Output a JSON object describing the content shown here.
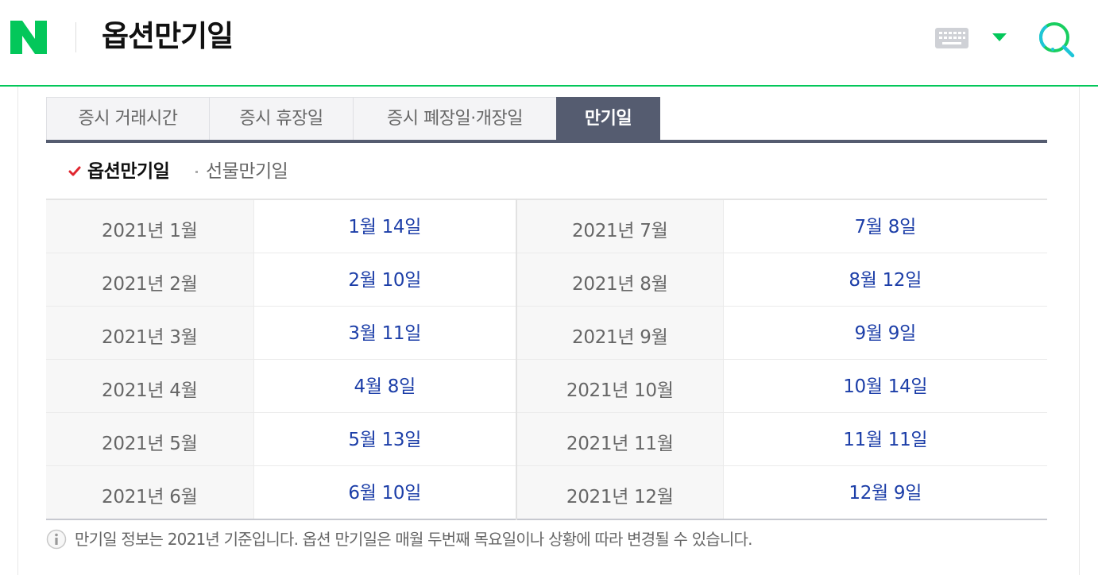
{
  "header": {
    "logo_letter": "N",
    "title": "옵션만기일",
    "keyboard_icon": "keyboard-icon",
    "dropdown_icon": "caret-down-icon",
    "search_icon": "search-icon",
    "accent_color": "#03c75a"
  },
  "tabs": [
    {
      "label": "증시 거래시간",
      "active": false
    },
    {
      "label": "증시 휴장일",
      "active": false
    },
    {
      "label": "증시 폐장일·개장일",
      "active": false
    },
    {
      "label": "만기일",
      "active": true
    }
  ],
  "subtabs": {
    "active_label": "옵션만기일",
    "inactive_label": "선물만기일",
    "check_color": "#e0262f"
  },
  "table": {
    "rows": [
      {
        "m1": "2021년 1월",
        "d1": "1월 14일",
        "m2": "2021년 7월",
        "d2": "7월 8일"
      },
      {
        "m1": "2021년 2월",
        "d1": "2월 10일",
        "m2": "2021년 8월",
        "d2": "8월 12일"
      },
      {
        "m1": "2021년 3월",
        "d1": "3월 11일",
        "m2": "2021년 9월",
        "d2": "9월 9일"
      },
      {
        "m1": "2021년 4월",
        "d1": "4월 8일",
        "m2": "2021년 10월",
        "d2": "10월 14일"
      },
      {
        "m1": "2021년 5월",
        "d1": "5월 13일",
        "m2": "2021년 11월",
        "d2": "11월 11일"
      },
      {
        "m1": "2021년 6월",
        "d1": "6월 10일",
        "m2": "2021년 12월",
        "d2": "12월 9일"
      }
    ]
  },
  "notice": {
    "icon": "info-icon",
    "text": "만기일 정보는 2021년 기준입니다. 옵션 만기일은 매월 두번째 목요일이나 상황에 따라 변경될 수 있습니다."
  }
}
